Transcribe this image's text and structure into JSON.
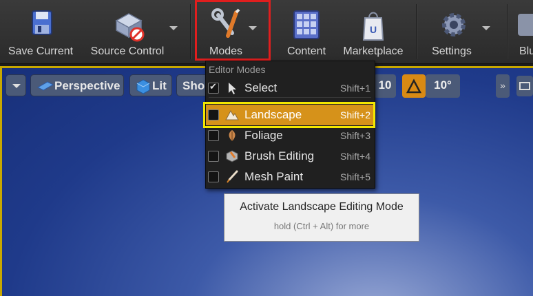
{
  "toolbar": {
    "save_current": "Save Current",
    "source_control": "Source Control",
    "modes": "Modes",
    "content": "Content",
    "marketplace": "Marketplace",
    "settings": "Settings",
    "blueprints_partial": "Blu"
  },
  "viewport": {
    "perspective": "Perspective",
    "lit": "Lit",
    "show_partial": "Sho",
    "grid_value": "10",
    "angle_value": "10°",
    "more": "»"
  },
  "menu": {
    "header": "Editor Modes",
    "items": [
      {
        "label": "Select",
        "shortcut": "Shift+1",
        "checked": true,
        "highlighted": false,
        "icon": "cursor-icon"
      },
      {
        "label": "Landscape",
        "shortcut": "Shift+2",
        "checked": false,
        "highlighted": true,
        "icon": "mountain-icon"
      },
      {
        "label": "Foliage",
        "shortcut": "Shift+3",
        "checked": false,
        "highlighted": false,
        "icon": "leaf-icon"
      },
      {
        "label": "Brush Editing",
        "shortcut": "Shift+4",
        "checked": false,
        "highlighted": false,
        "icon": "brush-cube-icon"
      },
      {
        "label": "Mesh Paint",
        "shortcut": "Shift+5",
        "checked": false,
        "highlighted": false,
        "icon": "paintbrush-icon"
      }
    ]
  },
  "tooltip": {
    "title": "Activate Landscape Editing Mode",
    "subtitle": "hold (Ctrl + Alt) for more"
  },
  "colors": {
    "highlight": "#d6921a",
    "red_callout": "#e01e1e",
    "yellow_callout": "#f2e600"
  }
}
